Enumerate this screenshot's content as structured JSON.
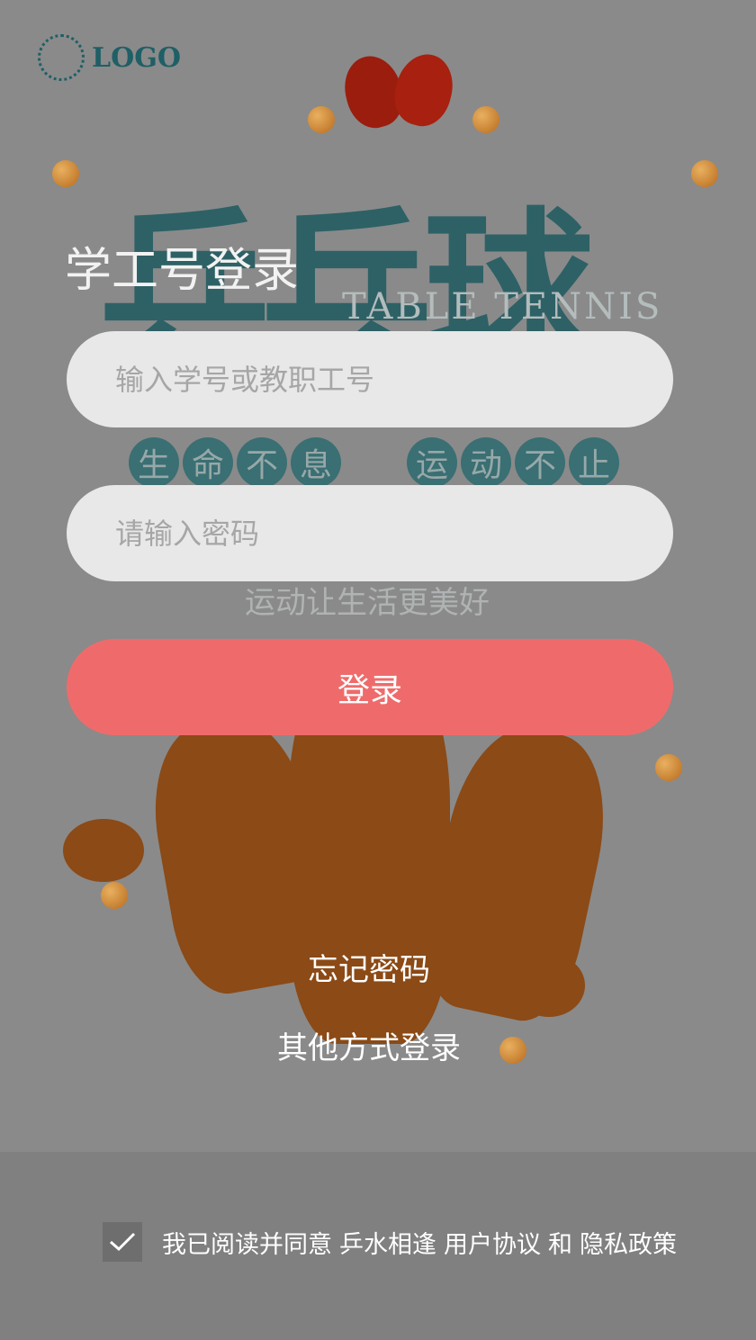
{
  "poster": {
    "logo_text": "LOGO",
    "headline": "乒乓球",
    "english": "TABLE TENNIS",
    "slogan_left": [
      "生",
      "命",
      "不",
      "息"
    ],
    "slogan_right": [
      "运",
      "动",
      "不",
      "止"
    ],
    "tagline": "运动让生活更美好"
  },
  "form": {
    "title": "学工号登录",
    "account_placeholder": "输入学号或教职工号",
    "password_placeholder": "请输入密码",
    "login_label": "登录",
    "forgot_label": "忘记密码",
    "other_login_label": "其他方式登录"
  },
  "agreement": {
    "checked": true,
    "prefix": "我已阅读并同意",
    "brand": "乒水相逢",
    "terms": "用户协议",
    "and": "和",
    "privacy": "隐私政策"
  },
  "colors": {
    "accent": "#ef6b6b",
    "background": "#808080"
  }
}
